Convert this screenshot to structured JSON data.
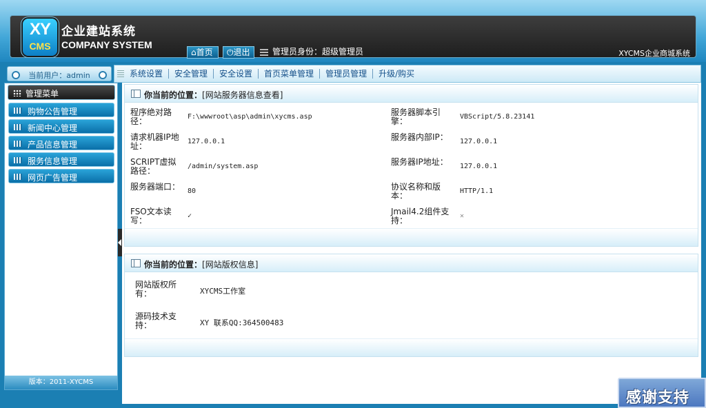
{
  "header": {
    "logo_xy": "XY",
    "logo_cms": "CMS",
    "logo_cn": "企业建站系统",
    "logo_en": "COMPANY SYSTEM",
    "home_label": "首页",
    "exit_label": "退出",
    "admin_role": "管理员身份：超级管理员",
    "brand_right": "XYCMS企业商城系统"
  },
  "user_bar": {
    "label": "当前用户：admin"
  },
  "top_nav": {
    "items": [
      "系统设置",
      "安全管理",
      "安全设置",
      "首页菜单管理",
      "管理员管理",
      "升级/购买"
    ]
  },
  "sidebar": {
    "menu_title": "管理菜单",
    "items": [
      "购物公告管理",
      "新闻中心管理",
      "产品信息管理",
      "服务信息管理",
      "网页广告管理"
    ],
    "footer": "版本：2011-XYCMS"
  },
  "server_panel": {
    "title_bold": "你当前的位置：",
    "title_rest": "[网站服务器信息查看]",
    "rows": [
      {
        "k1": "程序绝对路径：",
        "v1": "F:\\wwwroot\\asp\\admin\\xycms.asp",
        "k2": "服务器脚本引擎：",
        "v2": "VBScript/5.8.23141"
      },
      {
        "k1": "请求机器IP地址：",
        "v1": "127.0.0.1",
        "k2": "服务器内部IP：",
        "v2": "127.0.0.1"
      },
      {
        "k1": "SCRIPT虚拟路径：",
        "v1": "/admin/system.asp",
        "k2": "服务器IP地址：",
        "v2": "127.0.0.1"
      },
      {
        "k1": "服务器端口：",
        "v1": "80",
        "k2": "协议名称和版本：",
        "v2": "HTTP/1.1"
      },
      {
        "k1": "FSO文本读写：",
        "v1": "✓",
        "k2": "Jmail4.2组件支持：",
        "v2": "✕"
      }
    ]
  },
  "copyright_panel": {
    "title_bold": "你当前的位置：",
    "title_rest": "[网站版权信息]",
    "rows": [
      {
        "k": "网站版权所有：",
        "v": "XYCMS工作室"
      },
      {
        "k": "源码技术支持：",
        "v": "XY   联系QQ:364500483"
      }
    ]
  },
  "thanks": {
    "label": "感谢支持"
  },
  "colors": {
    "accent": "#1b7fb3",
    "menu_blue": "#0a6fa8",
    "header_dark": "#1e1e1e"
  }
}
